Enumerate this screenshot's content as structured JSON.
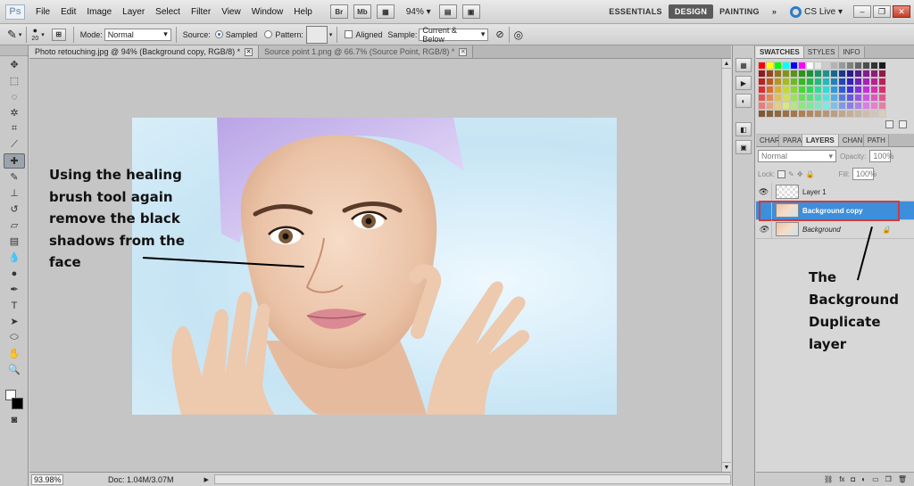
{
  "menubar": {
    "logo": "Ps",
    "items": [
      "File",
      "Edit",
      "Image",
      "Layer",
      "Select",
      "Filter",
      "View",
      "Window",
      "Help"
    ],
    "bridge_buttons": [
      "Br",
      "Mb"
    ],
    "zoom": "94%",
    "workspaces": [
      "ESSENTIALS",
      "DESIGN",
      "PAINTING"
    ],
    "active_workspace": "DESIGN",
    "more": "»",
    "cs_live": "CS Live"
  },
  "options": {
    "brush_size": "20",
    "mode_label": "Mode:",
    "mode_value": "Normal",
    "source_label": "Source:",
    "sampled_label": "Sampled",
    "pattern_label": "Pattern:",
    "aligned_label": "Aligned",
    "sample_label": "Sample:",
    "sample_value": "Current & Below"
  },
  "documents": {
    "tabs": [
      {
        "title": "Photo retouching.jpg @ 94% (Background copy, RGB/8) *",
        "active": true
      },
      {
        "title": "Source point 1.png @ 66.7% (Source Point, RGB/8) *",
        "active": false
      }
    ]
  },
  "status": {
    "zoom": "93.98%",
    "doc": "Doc: 1.04M/3.07M"
  },
  "annotations": {
    "healing": "Using the healing brush tool again remove the black shadows from the face",
    "layer": "The Background Duplicate layer"
  },
  "panels": {
    "top_tabs": [
      "SWATCHES",
      "STYLES",
      "INFO"
    ],
    "layer_tabs": [
      "CHAR",
      "PARA",
      "LAYERS",
      "CHAN",
      "PATH"
    ],
    "active_layer_tab": "LAYERS",
    "blend_mode": "Normal",
    "opacity_label": "Opacity:",
    "opacity_value": "100%",
    "lock_label": "Lock:",
    "fill_label": "Fill:",
    "fill_value": "100%",
    "layers": [
      {
        "name": "Layer 1",
        "visible": true,
        "selected": false,
        "thumb": "checker"
      },
      {
        "name": "Background copy",
        "visible": false,
        "selected": true,
        "thumb": "face"
      },
      {
        "name": "Background",
        "visible": true,
        "selected": false,
        "thumb": "face",
        "locked": true
      }
    ]
  },
  "colors": {
    "selected_layer": "#3d8edb",
    "highlight_border": "#d23b3b",
    "active_workspace_bg": "#5a5a5a"
  }
}
